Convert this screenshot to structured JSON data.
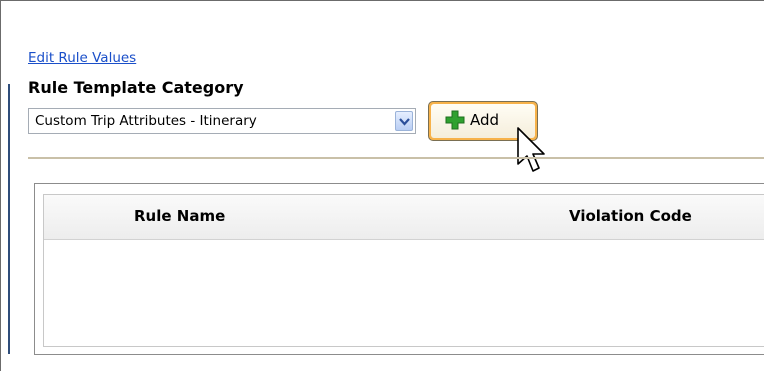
{
  "links": {
    "edit_rule_values": "Edit Rule Values"
  },
  "rule_template_category": {
    "title": "Rule Template Category",
    "selected": "Custom Trip Attributes - Itinerary"
  },
  "add_button": {
    "label": "Add",
    "icon": "plus-icon"
  },
  "grid": {
    "columns": [
      "Rule Name",
      "Violation Code"
    ],
    "rows": []
  },
  "colors": {
    "link": "#1a4fc9",
    "button_highlight": "#f7b24a",
    "plus_green": "#2fa12f"
  }
}
